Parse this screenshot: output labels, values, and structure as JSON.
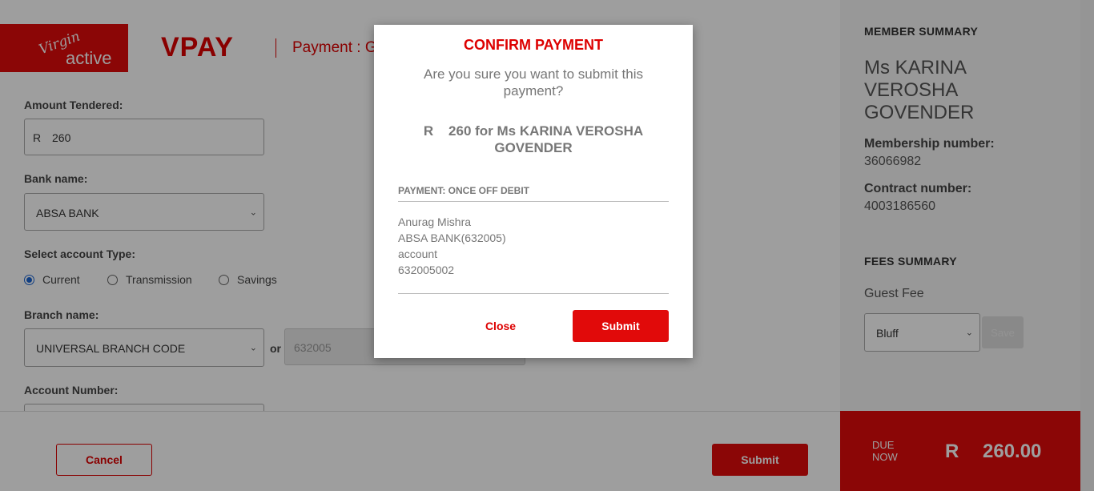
{
  "header": {
    "logo_line1": "Virgin",
    "logo_line2": "active",
    "brand": "VPAY",
    "title": "Payment : Guest Fee"
  },
  "form": {
    "amount_label": "Amount Tendered:",
    "currency": "R",
    "amount_value": "260",
    "bank_label": "Bank name:",
    "bank_value": "ABSA BANK",
    "account_type_label": "Select account Type:",
    "account_types": [
      "Current",
      "Transmission",
      "Savings"
    ],
    "account_type_selected": "Current",
    "branch_label": "Branch name:",
    "branch_value": "UNIVERSAL BRANCH CODE",
    "or_label": "or",
    "branch_code": "632005",
    "account_number_label": "Account Number:"
  },
  "footer": {
    "cancel_label": "Cancel",
    "submit_label": "Submit"
  },
  "summary": {
    "member_heading": "MEMBER SUMMARY",
    "member_name": "Ms KARINA VEROSHA GOVENDER",
    "membership_number_label": "Membership number:",
    "membership_number": "36066982",
    "contract_number_label": "Contract number:",
    "contract_number": "4003186560",
    "fees_heading": "FEES SUMMARY",
    "fee_name": "Guest Fee",
    "fee_select_value": "Bluff",
    "save_label": "Save",
    "due_label": "DUE NOW",
    "due_currency": "R",
    "due_amount": "260.00"
  },
  "modal": {
    "title": "CONFIRM PAYMENT",
    "question": "Are you sure you want to submit this payment?",
    "amount_line": "R    260 for Ms KARINA VEROSHA GOVENDER",
    "payment_type": "PAYMENT: ONCE OFF DEBIT",
    "account_holder": "Anurag Mishra",
    "bank_line": "ABSA BANK(632005)",
    "account_type": "account",
    "account_number": "632005002",
    "close_label": "Close",
    "submit_label": "Submit"
  },
  "colors": {
    "brand_red": "#e10a0a",
    "overlay": "rgba(0,0,0,0.38)"
  }
}
